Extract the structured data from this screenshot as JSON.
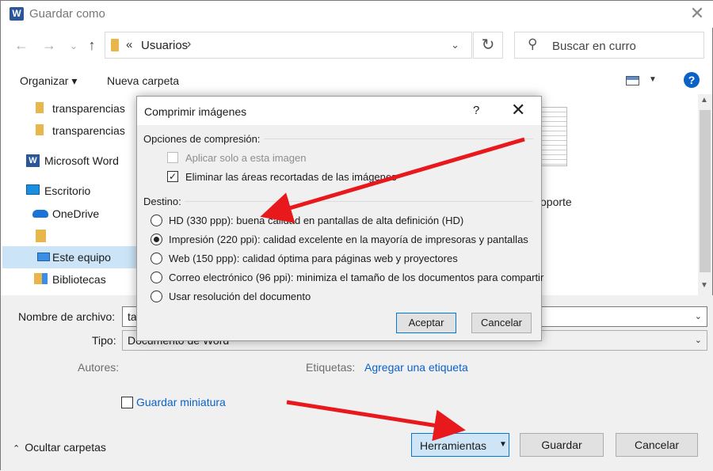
{
  "window": {
    "title": "Guardar como",
    "icon_letter": "W"
  },
  "address": {
    "prefix": "«",
    "crumb": "Usuarios",
    "separator": "›",
    "dropdown": "⌄"
  },
  "search": {
    "placeholder": "Buscar en curro"
  },
  "toolbar": {
    "organize_label": "Organizar ▾",
    "new_folder_label": "Nueva carpeta"
  },
  "sidebar": {
    "items": [
      {
        "label": "transparencias",
        "icon": "folder-icon"
      },
      {
        "label": "transparencias",
        "icon": "folder-icon"
      },
      {
        "label": "Microsoft Word",
        "icon": "word-icon"
      },
      {
        "label": "Escritorio",
        "icon": "desktop-icon"
      },
      {
        "label": "OneDrive",
        "icon": "cloud-icon"
      },
      {
        "label": "",
        "icon": "user-folder-icon"
      },
      {
        "label": "Este equipo",
        "icon": "computer-icon",
        "selected": true
      },
      {
        "label": "Bibliotecas",
        "icon": "library-icon"
      }
    ]
  },
  "files": {
    "partial_label": "oporte"
  },
  "form": {
    "filename_label": "Nombre de archivo:",
    "filename_value": "ta",
    "type_label": "Tipo:",
    "type_value": "Documento de Word",
    "authors_label": "Autores:",
    "tags_label": "Etiquetas:",
    "tags_link": "Agregar una etiqueta",
    "thumb_label": "Guardar miniatura"
  },
  "buttons": {
    "hide_folders": "Ocultar carpetas",
    "tools": "Herramientas",
    "save": "Guardar",
    "cancel": "Cancelar"
  },
  "modal": {
    "title": "Comprimir imágenes",
    "help": "?",
    "close": "✕",
    "compression_group": "Opciones de compresión:",
    "apply_only": "Aplicar solo a esta imagen",
    "delete_cropped": "Eliminar las áreas recortadas de las imágenes",
    "target_group": "Destino:",
    "options": [
      "HD (330 ppp): buena calidad en pantallas de alta definición (HD)",
      "Impresión (220 ppi): calidad excelente en la mayoría de impresoras y pantallas",
      "Web (150 ppp): calidad óptima para páginas web y proyectores",
      "Correo electrónico (96 ppi): minimiza el tamaño de los documentos para compartir",
      "Usar resolución del documento"
    ],
    "selected_option_index": 1,
    "ok": "Aceptar",
    "cancel": "Cancelar"
  },
  "colors": {
    "accent": "#0078d7",
    "annotation_arrow": "#e8191c"
  }
}
